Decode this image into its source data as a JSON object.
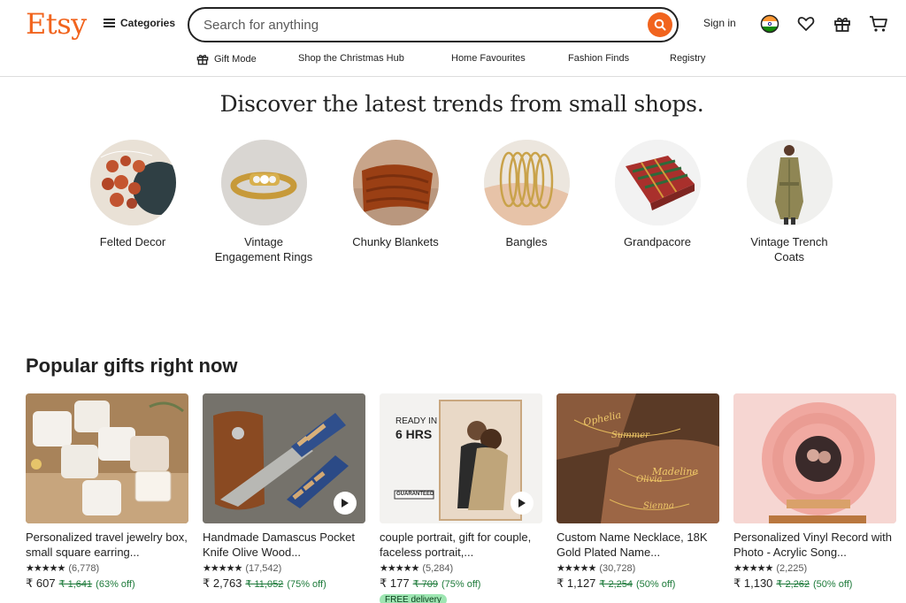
{
  "header": {
    "logo": "Etsy",
    "categories_label": "Categories",
    "search_placeholder": "Search for anything",
    "signin_label": "Sign in",
    "subnav": [
      "Gift Mode",
      "Shop the Christmas Hub",
      "Home Favourites",
      "Fashion Finds",
      "Registry"
    ]
  },
  "colors": {
    "brand": "#f1641e",
    "discount": "#1d7a3a",
    "free_delivery_bg": "#9ee6b2"
  },
  "discover": {
    "title": "Discover the latest trends from small shops.",
    "items": [
      {
        "label": "Felted Decor"
      },
      {
        "label": "Vintage Engagement Rings"
      },
      {
        "label": "Chunky Blankets"
      },
      {
        "label": "Bangles"
      },
      {
        "label": "Grandpacore"
      },
      {
        "label": "Vintage Trench Coats"
      }
    ]
  },
  "popular": {
    "title": "Popular gifts right now",
    "cards": [
      {
        "title": "Personalized travel jewelry box, small square earring...",
        "stars": "★★★★★",
        "reviews": "(6,778)",
        "price": "₹ 607",
        "was": "₹ 1,641",
        "off": "(63% off)"
      },
      {
        "title": "Handmade Damascus Pocket Knife Olive Wood...",
        "stars": "★★★★★",
        "reviews": "(17,542)",
        "price": "₹ 2,763",
        "was": "₹ 11,052",
        "off": "(75% off)"
      },
      {
        "title": "couple portrait, gift for couple, faceless portrait,...",
        "stars": "★★★★★",
        "reviews": "(5,284)",
        "price": "₹ 177",
        "was": "₹ 709",
        "off": "(75% off)",
        "badge": "FREE delivery",
        "overlay_line1": "READY IN",
        "overlay_line2": "6 HRS",
        "overlay_stamp": "GUARANTEED"
      },
      {
        "title": "Custom Name Necklace, 18K Gold Plated Name...",
        "stars": "★★★★★",
        "reviews": "(30,728)",
        "price": "₹ 1,127",
        "was": "₹ 2,254",
        "off": "(50% off)"
      },
      {
        "title": "Personalized Vinyl Record with Photo - Acrylic Song...",
        "stars": "★★★★★",
        "reviews": "(2,225)",
        "price": "₹ 1,130",
        "was": "₹ 2,262",
        "off": "(50% off)"
      }
    ]
  }
}
